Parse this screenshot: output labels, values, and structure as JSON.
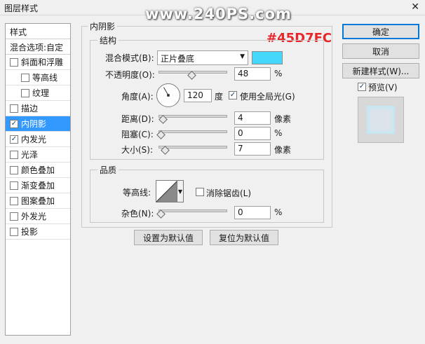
{
  "window": {
    "title": "图层样式",
    "close_glyph": "✕",
    "watermark": "www.240PS.com",
    "hex_annotation": "#45D7FC"
  },
  "style_list": {
    "header": "样式",
    "blend_options": "混合选项:自定",
    "items": [
      {
        "label": "斜面和浮雕",
        "checked": false,
        "sub": false,
        "selected": false
      },
      {
        "label": "等高线",
        "checked": false,
        "sub": true,
        "selected": false
      },
      {
        "label": "纹理",
        "checked": false,
        "sub": true,
        "selected": false
      },
      {
        "label": "描边",
        "checked": false,
        "sub": false,
        "selected": false
      },
      {
        "label": "内阴影",
        "checked": true,
        "sub": false,
        "selected": true
      },
      {
        "label": "内发光",
        "checked": true,
        "sub": false,
        "selected": false
      },
      {
        "label": "光泽",
        "checked": false,
        "sub": false,
        "selected": false
      },
      {
        "label": "颜色叠加",
        "checked": false,
        "sub": false,
        "selected": false
      },
      {
        "label": "渐变叠加",
        "checked": false,
        "sub": false,
        "selected": false
      },
      {
        "label": "图案叠加",
        "checked": false,
        "sub": false,
        "selected": false
      },
      {
        "label": "外发光",
        "checked": false,
        "sub": false,
        "selected": false
      },
      {
        "label": "投影",
        "checked": false,
        "sub": false,
        "selected": false
      }
    ]
  },
  "inner_shadow": {
    "section_title": "内阴影",
    "structure": {
      "title": "结构",
      "blend_mode_label": "混合模式(B):",
      "blend_mode_value": "正片叠底",
      "color": "#45D7FC",
      "opacity_label": "不透明度(O):",
      "opacity_value": "48",
      "opacity_fraction": 0.48,
      "percent": "%",
      "angle_label": "角度(A):",
      "angle_value": "120",
      "degree": "度",
      "global_light_label": "使用全局光(G)",
      "global_light_checked": true,
      "distance_label": "距离(D):",
      "distance_value": "4",
      "choke_label": "阻塞(C):",
      "choke_value": "0",
      "size_label": "大小(S):",
      "size_value": "7",
      "pixel_unit": "像素"
    },
    "quality": {
      "title": "品质",
      "contour_label": "等高线:",
      "anti_alias_label": "消除锯齿(L)",
      "anti_alias_checked": false,
      "noise_label": "杂色(N):",
      "noise_value": "0"
    },
    "set_default": "设置为默认值",
    "reset_default": "复位为默认值"
  },
  "buttons": {
    "ok": "确定",
    "cancel": "取消",
    "new_style": "新建样式(W)...",
    "preview_label": "预览(V)",
    "preview_checked": true
  },
  "icons": {
    "check": "check-icon",
    "dropdown": "chevron-down-icon",
    "close": "close-icon"
  }
}
